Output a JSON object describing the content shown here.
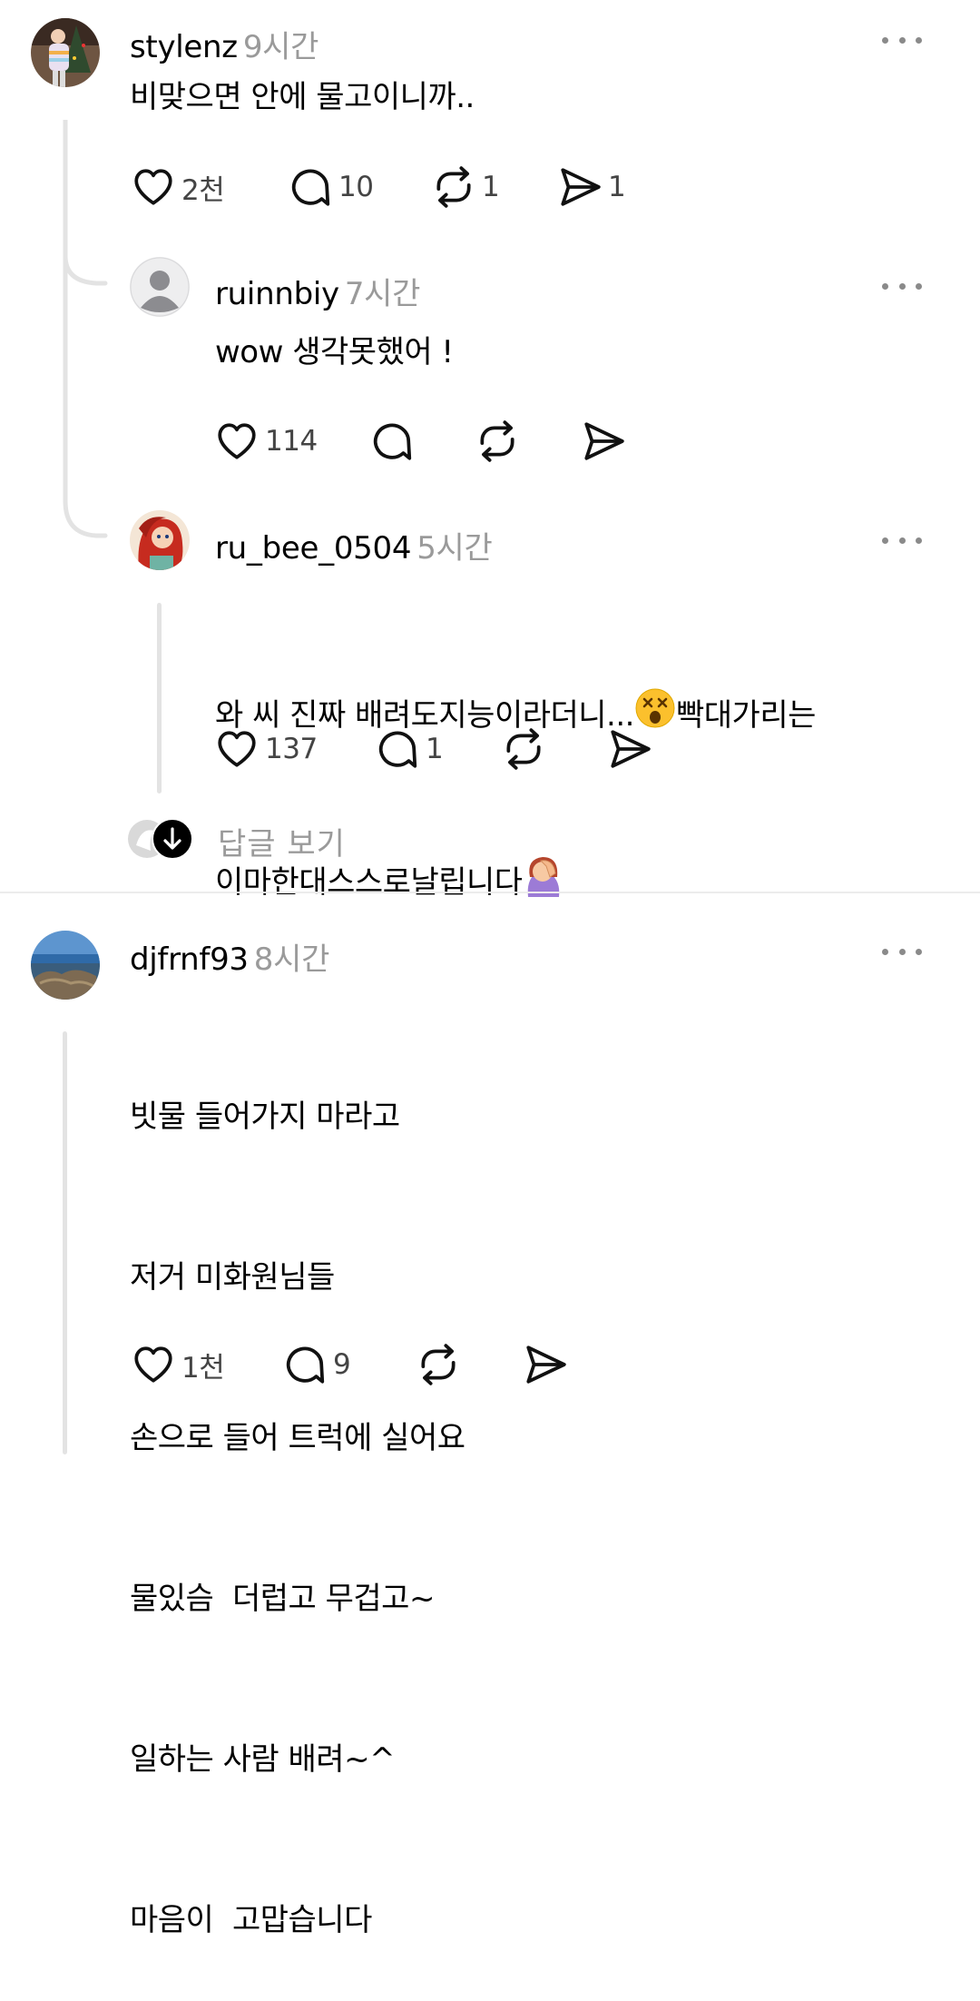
{
  "comments": [
    {
      "username": "stylenz",
      "time": "9시간",
      "text": "비맞으면 안에 물고이니까..",
      "likes": "2천",
      "replies": "10",
      "reposts": "1",
      "shares": "1"
    },
    {
      "username": "ruinnbiy",
      "time": "7시간",
      "text": "wow 생각못했어 !",
      "likes": "114"
    },
    {
      "username": "ru_bee_0504",
      "time": "5시간",
      "text_line1_a": "와 씨 진짜 배려도지능이라더니...",
      "text_line1_b": "빡대가리는",
      "text_line2": "이마한대스스로날립니다",
      "likes": "137",
      "replies": "1"
    },
    {
      "username": "djfrnf93",
      "time": "8시간",
      "lines": [
        "빗물 들어가지 마라고",
        "저거 미화원님들",
        "손으로 들어 트럭에 실어요",
        "물있슴  더럽고 무겁고~",
        "일하는 사람 배려~^",
        "마음이  고맙습니다"
      ],
      "likes": "1천",
      "replies": "9"
    }
  ],
  "view_replies_label": "답글 보기",
  "icons": {
    "like": "heart-icon",
    "reply": "comment-bubble-icon",
    "repost": "repost-icon",
    "share": "send-icon",
    "more": "more-dots-icon",
    "emoji_1": "dizzy-face-emoji",
    "emoji_2": "face-palm-emoji",
    "expand": "arrow-down-icon"
  },
  "colors": {
    "text": "#000000",
    "muted": "#9a9a9a",
    "thread_line": "#e3e3e3",
    "divider": "#ececec"
  }
}
